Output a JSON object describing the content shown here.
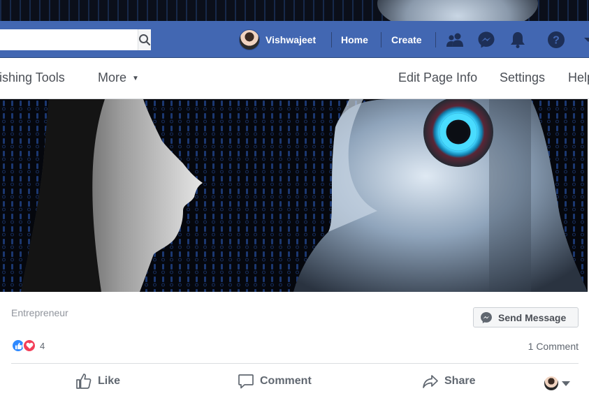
{
  "header": {
    "search": {
      "value": "",
      "placeholder": ""
    },
    "profile_name": "Vishwajeet",
    "nav": {
      "home": "Home",
      "create": "Create"
    },
    "icons": [
      "friends-icon",
      "messenger-icon",
      "notifications-icon",
      "help-icon",
      "account-menu-icon"
    ],
    "brand_color": "#4267b2"
  },
  "page_nav": {
    "publishing_tools": "Publishing Tools",
    "more": "More",
    "edit_page_info": "Edit Page Info",
    "settings": "Settings",
    "help": "Help"
  },
  "cover": {
    "image": "cover-photo"
  },
  "post": {
    "category": "Entrepreneur",
    "send_message": "Send Message",
    "reaction_count": "4",
    "comments": "1 Comment",
    "actions": {
      "like": "Like",
      "comment": "Comment",
      "share": "Share"
    }
  }
}
